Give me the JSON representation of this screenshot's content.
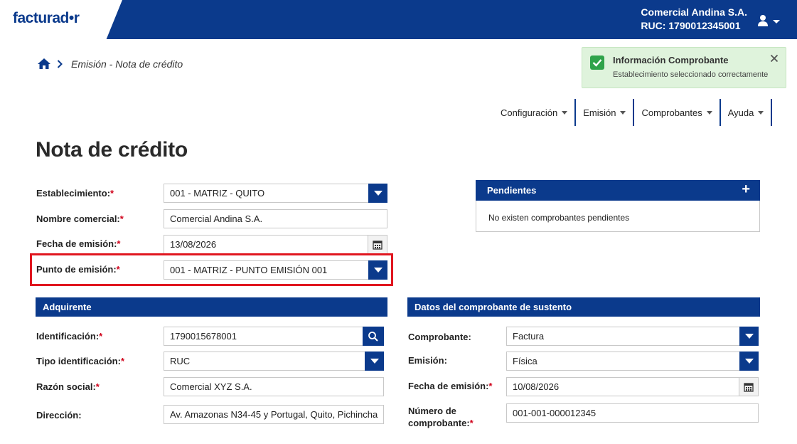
{
  "header": {
    "logo_text": "facturad•r",
    "company_name": "Comercial Andina S.A.",
    "ruc": "RUC: 1790012345001"
  },
  "breadcrumb": {
    "current": "Emisión - Nota de crédito"
  },
  "toast": {
    "title": "Información Comprobante",
    "message": "Establecimiento seleccionado correctamente"
  },
  "nav": [
    {
      "label": "Configuración"
    },
    {
      "label": "Emisión"
    },
    {
      "label": "Comprobantes"
    },
    {
      "label": "Ayuda"
    }
  ],
  "page_title": "Nota de crédito",
  "form": {
    "establecimiento": {
      "label": "Establecimiento:",
      "value": "001 - MATRIZ - QUITO"
    },
    "nombre_comercial": {
      "label": "Nombre comercial:",
      "value": "Comercial Andina S.A."
    },
    "fecha_emision": {
      "label": "Fecha de emisión:",
      "value": "13/08/2026"
    },
    "punto_emision": {
      "label": "Punto de emisión:",
      "value": "001 - MATRIZ - PUNTO EMISIÓN 001"
    }
  },
  "pendientes": {
    "title": "Pendientes",
    "message": "No existen comprobantes pendientes"
  },
  "adquirente": {
    "title": "Adquirente",
    "identificacion": {
      "label": "Identificación:",
      "value": "1790015678001"
    },
    "tipo_identificacion": {
      "label": "Tipo identificación:",
      "value": "RUC"
    },
    "razon_social": {
      "label": "Razón social:",
      "value": "Comercial XYZ S.A."
    },
    "direccion": {
      "label": "Dirección:",
      "value": "Av. Amazonas N34-45 y Portugal, Quito, Pichincha"
    }
  },
  "sustento": {
    "title": "Datos del comprobante de sustento",
    "comprobante": {
      "label": "Comprobante:",
      "value": "Factura"
    },
    "emision": {
      "label": "Emisión:",
      "value": "Física"
    },
    "fecha_emision": {
      "label": "Fecha de emisión:",
      "value": "10/08/2026"
    },
    "numero": {
      "label_line1": "Número de",
      "label_line2": "comprobante:",
      "value": "001-001-000012345"
    }
  },
  "required_mark": "*",
  "colors": {
    "brand": "#0b3a8c",
    "required": "#d0021b",
    "success": "#2fa34a",
    "highlight": "#e0161f"
  }
}
